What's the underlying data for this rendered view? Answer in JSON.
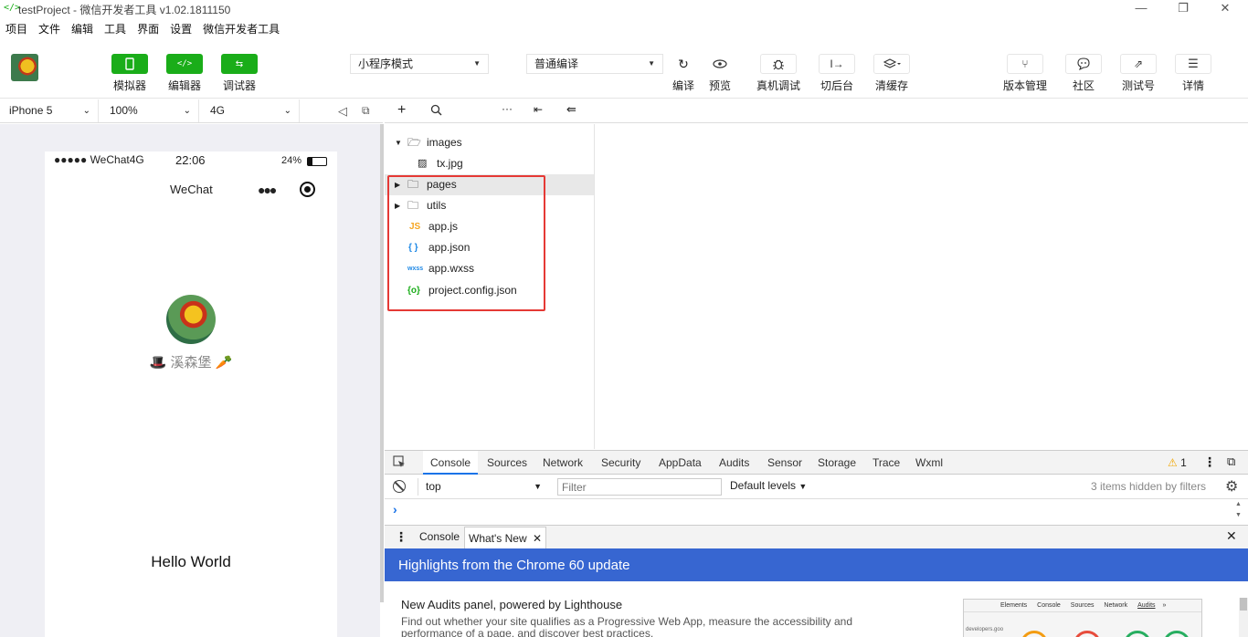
{
  "window": {
    "title": "testProject - 微信开发者工具 v1.02.1811150",
    "app_icon": "</>"
  },
  "menu": [
    "项目",
    "文件",
    "编辑",
    "工具",
    "界面",
    "设置",
    "微信开发者工具"
  ],
  "toolbar": {
    "left_buttons": [
      {
        "label": "模拟器",
        "icon": "phone-icon"
      },
      {
        "label": "编辑器",
        "icon": "code-icon"
      },
      {
        "label": "调试器",
        "icon": "swap-icon"
      }
    ],
    "mode_select": "小程序模式",
    "compile_select": "普通编译",
    "mid_buttons": [
      {
        "label": "编译",
        "icon": "refresh-icon"
      },
      {
        "label": "预览",
        "icon": "eye-icon"
      },
      {
        "label": "真机调试",
        "icon": "bug-icon"
      },
      {
        "label": "切后台",
        "icon": "switch-bg-icon"
      },
      {
        "label": "清缓存",
        "icon": "layers-icon"
      }
    ],
    "right_buttons": [
      {
        "label": "版本管理",
        "icon": "branch-icon"
      },
      {
        "label": "社区",
        "icon": "chat-icon"
      },
      {
        "label": "测试号",
        "icon": "external-icon"
      },
      {
        "label": "详情",
        "icon": "menu-icon"
      }
    ]
  },
  "simulator": {
    "device": "iPhone 5",
    "zoom": "100%",
    "network": "4G",
    "status": {
      "carrier": "●●●●● WeChat4G",
      "time": "22:06",
      "battery": "24%"
    },
    "nav_title": "WeChat",
    "nickname": "溪森堡",
    "body_text": "Hello World"
  },
  "filetree": {
    "items": [
      {
        "name": "images",
        "type": "folder",
        "expanded": true
      },
      {
        "name": "tx.jpg",
        "type": "image"
      },
      {
        "name": "pages",
        "type": "folder",
        "expanded": false
      },
      {
        "name": "utils",
        "type": "folder",
        "expanded": false
      },
      {
        "name": "app.js",
        "type": "js",
        "badge": "JS"
      },
      {
        "name": "app.json",
        "type": "json",
        "badge": "{ }"
      },
      {
        "name": "app.wxss",
        "type": "wxss",
        "badge": "wxss"
      },
      {
        "name": "project.config.json",
        "type": "config",
        "badge": "{o}"
      }
    ]
  },
  "devtools": {
    "tabs": [
      "Console",
      "Sources",
      "Network",
      "Security",
      "AppData",
      "Audits",
      "Sensor",
      "Storage",
      "Trace",
      "Wxml"
    ],
    "warning_count": "1",
    "context": "top",
    "filter_placeholder": "Filter",
    "levels": "Default levels",
    "hidden_info": "3 items hidden by filters",
    "prompt": "›",
    "drawer_tabs": [
      "Console",
      "What's New"
    ],
    "banner": "Highlights from the Chrome 60 update",
    "news_title": "New Audits panel, powered by Lighthouse",
    "news_body": "Find out whether your site qualifies as a Progressive Web App, measure the accessibility and performance of a page, and discover best practices.",
    "thumb_tabs": [
      "Elements",
      "Console",
      "Sources",
      "Network",
      "Audits",
      "»"
    ],
    "thumb_url": "developers.goo"
  },
  "colors": {
    "green": "#1aad19",
    "banner_blue": "#3766d1",
    "highlight_red": "#e53935"
  }
}
